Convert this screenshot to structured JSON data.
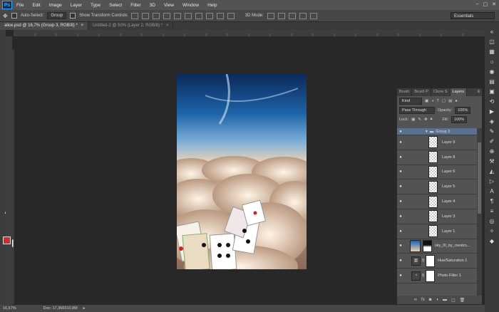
{
  "app": {
    "logo": "Ps"
  },
  "menu": [
    "File",
    "Edit",
    "Image",
    "Layer",
    "Type",
    "Select",
    "Filter",
    "3D",
    "View",
    "Window",
    "Help"
  ],
  "window_controls": {
    "minimize": "–",
    "maximize": "▢",
    "close": "✕"
  },
  "options": {
    "auto_select_label": "Auto-Select:",
    "auto_select_value": "Group",
    "transform_label": "Show Transform Controls",
    "mode_label": "3D Mode:",
    "workspace": "Essentials"
  },
  "tabs": [
    {
      "label": "alice.psd @ 16,7% (Group 3, RGB/8) *",
      "close": "×"
    },
    {
      "label": "Untitled-2 @ 50% (Layer 2, RGB/8) *",
      "close": "×"
    }
  ],
  "status": {
    "zoom": "16,67%",
    "doc": "Doc: 17,3M/310,8M"
  },
  "layers_panel": {
    "tabs": [
      "Brush",
      "Brush P",
      "Clone S",
      "Layers"
    ],
    "active_tab": "Layers",
    "kind_label": "Kind",
    "blend_mode": "Pass Through",
    "opacity_label": "Opacity:",
    "opacity_value": "100%",
    "lock_label": "Lock:",
    "fill_label": "Fill:",
    "fill_value": "100%",
    "layers": [
      {
        "name": "Group 3",
        "type": "group"
      },
      {
        "name": "Layer 9",
        "type": "pixel"
      },
      {
        "name": "Layer 8",
        "type": "pixel"
      },
      {
        "name": "Layer 6",
        "type": "pixel"
      },
      {
        "name": "Layer 5",
        "type": "pixel"
      },
      {
        "name": "Layer 4",
        "type": "pixel"
      },
      {
        "name": "Layer 3",
        "type": "pixel"
      },
      {
        "name": "Layer 1",
        "type": "pixel"
      },
      {
        "name": "sky_III_by_mestro...",
        "type": "image"
      },
      {
        "name": "Hue/Saturation 1",
        "type": "adjustment"
      },
      {
        "name": "Photo Filter 1",
        "type": "adjustment"
      }
    ],
    "footer_icons": [
      "link-icon",
      "fx-icon",
      "mask-icon",
      "adjustment-icon",
      "folder-icon",
      "new-layer-icon",
      "trash-icon"
    ]
  },
  "colors": {
    "foreground": "#d22b2b",
    "background": "#ffffff"
  }
}
